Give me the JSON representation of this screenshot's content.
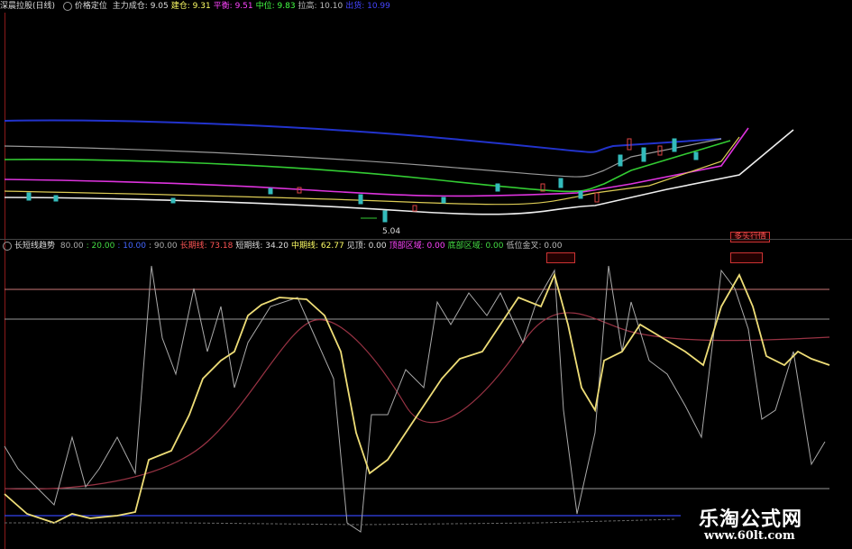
{
  "top_header": {
    "name": "深晨拉股(日线)",
    "indicator": "价格定位",
    "items": [
      {
        "label": "主力成仓: 9.05",
        "color": "#dddddd"
      },
      {
        "label": "建仓: 9.31",
        "color": "#ffff66"
      },
      {
        "label": "平衡: 9.51",
        "color": "#ff44ff"
      },
      {
        "label": "中位: 9.83",
        "color": "#44ff44"
      },
      {
        "label": "拉高: 10.10",
        "color": "#bbbbbb"
      },
      {
        "label": "出货: 10.99",
        "color": "#4444ff"
      }
    ]
  },
  "bottom_header": {
    "name": "长短线趋势",
    "items": [
      {
        "label": "80.00",
        "color": "#aaaaaa"
      },
      {
        "label": ": 20.00",
        "color": "#44dd44"
      },
      {
        "label": ": 10.00",
        "color": "#4466ff"
      },
      {
        "label": ": 90.00",
        "color": "#aaaaaa"
      },
      {
        "label": "长期线: 73.18",
        "color": "#ff5555"
      },
      {
        "label": "短期线: 34.20",
        "color": "#dddddd"
      },
      {
        "label": "中期线: 62.77",
        "color": "#ffff66"
      },
      {
        "label": "见顶: 0.00",
        "color": "#dddddd"
      },
      {
        "label": "顶部区域: 0.00",
        "color": "#ff44ff"
      },
      {
        "label": "底部区域: 0.00",
        "color": "#44dd44"
      },
      {
        "label": "低位金叉: 0.00",
        "color": "#bbbbbb"
      }
    ]
  },
  "low_price_label": "5.04",
  "signal_label": "多头行情",
  "watermark": {
    "title": "乐淘公式网",
    "url": "www.60lt.com"
  }
}
